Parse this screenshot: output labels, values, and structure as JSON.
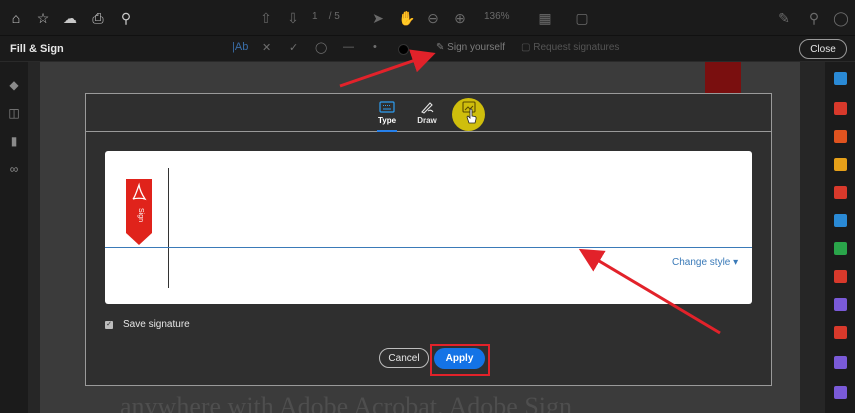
{
  "toolbar": {
    "page_current": "1",
    "page_sep": "/ 5",
    "zoom": "136%"
  },
  "fill_sign": {
    "title": "Fill & Sign",
    "text_tool": "|Ab",
    "sign_yourself": "Sign yourself",
    "initials": "Request signatures",
    "close_label": "Close"
  },
  "dialog": {
    "tabs": [
      {
        "label": "Type",
        "icon": "keyboard-icon"
      },
      {
        "label": "Draw",
        "icon": "pen-icon"
      },
      {
        "label": "",
        "icon": "image-icon"
      }
    ],
    "bookmark_text": "Sign",
    "change_style": "Change style ▾",
    "save_signature": "Save signature",
    "cancel_label": "Cancel",
    "apply_label": "Apply"
  },
  "document": {
    "text": "anywhere with Adobe Acrobat. Adobe Sign"
  },
  "colors": {
    "accent": "#1473e6",
    "annotation_red": "#e2222a",
    "highlight_yellow": "#d8c60b",
    "adobe_red": "#e0231b"
  }
}
